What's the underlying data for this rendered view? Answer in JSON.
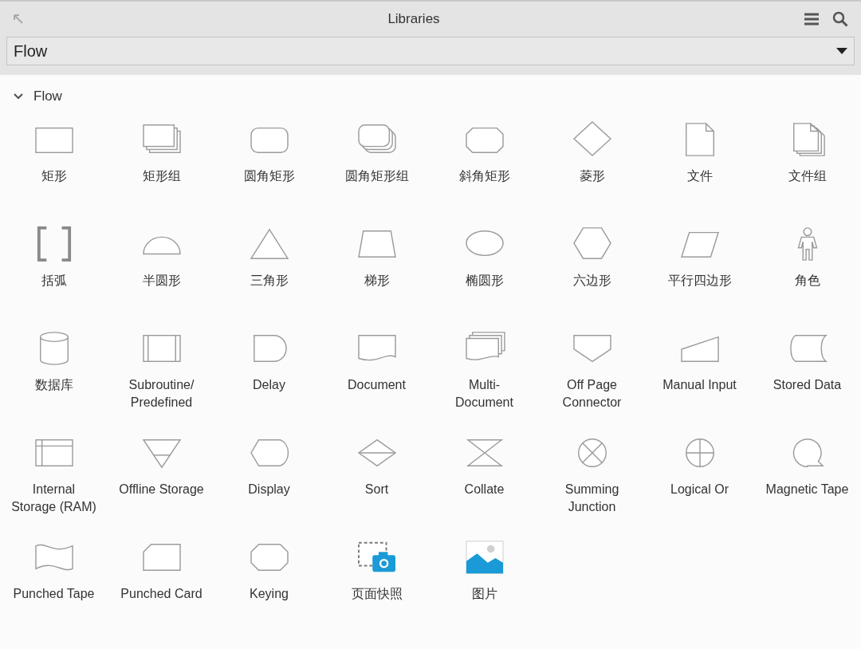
{
  "window": {
    "title": "Libraries"
  },
  "library_select": {
    "value": "Flow"
  },
  "section": {
    "title": "Flow",
    "expanded": true,
    "items": [
      {
        "label": "矩形",
        "kind": "rectangle"
      },
      {
        "label": "矩形组",
        "kind": "rectangle-group"
      },
      {
        "label": "圆角矩形",
        "kind": "rounded-rectangle"
      },
      {
        "label": "圆角矩形组",
        "kind": "rounded-rectangle-group"
      },
      {
        "label": "斜角矩形",
        "kind": "bevel-rectangle"
      },
      {
        "label": "菱形",
        "kind": "diamond"
      },
      {
        "label": "文件",
        "kind": "file"
      },
      {
        "label": "文件组",
        "kind": "file-group"
      },
      {
        "label": "括弧",
        "kind": "bracket"
      },
      {
        "label": "半圆形",
        "kind": "semicircle"
      },
      {
        "label": "三角形",
        "kind": "triangle"
      },
      {
        "label": "梯形",
        "kind": "trapezoid"
      },
      {
        "label": "椭圆形",
        "kind": "ellipse"
      },
      {
        "label": "六边形",
        "kind": "hexagon"
      },
      {
        "label": "平行四边形",
        "kind": "parallelogram"
      },
      {
        "label": "角色",
        "kind": "actor"
      },
      {
        "label": "数据库",
        "kind": "database"
      },
      {
        "label": "Subroutine/\nPredefined",
        "kind": "subroutine"
      },
      {
        "label": "Delay",
        "kind": "delay"
      },
      {
        "label": "Document",
        "kind": "document"
      },
      {
        "label": "Multi-\nDocument",
        "kind": "multi-document"
      },
      {
        "label": "Off Page\nConnector",
        "kind": "off-page"
      },
      {
        "label": "Manual Input",
        "kind": "manual-input"
      },
      {
        "label": "Stored Data",
        "kind": "stored-data"
      },
      {
        "label": "Internal\nStorage (RAM)",
        "kind": "internal-storage"
      },
      {
        "label": "Offline Storage",
        "kind": "offline-storage"
      },
      {
        "label": "Display",
        "kind": "display"
      },
      {
        "label": "Sort",
        "kind": "sort"
      },
      {
        "label": "Collate",
        "kind": "collate"
      },
      {
        "label": "Summing\nJunction",
        "kind": "summing-junction"
      },
      {
        "label": "Logical Or",
        "kind": "logical-or"
      },
      {
        "label": "Magnetic Tape",
        "kind": "magnetic-tape"
      },
      {
        "label": "Punched Tape",
        "kind": "punched-tape"
      },
      {
        "label": "Punched Card",
        "kind": "punched-card"
      },
      {
        "label": "Keying",
        "kind": "keying"
      },
      {
        "label": "页面快照",
        "kind": "snapshot"
      },
      {
        "label": "图片",
        "kind": "image"
      }
    ]
  }
}
